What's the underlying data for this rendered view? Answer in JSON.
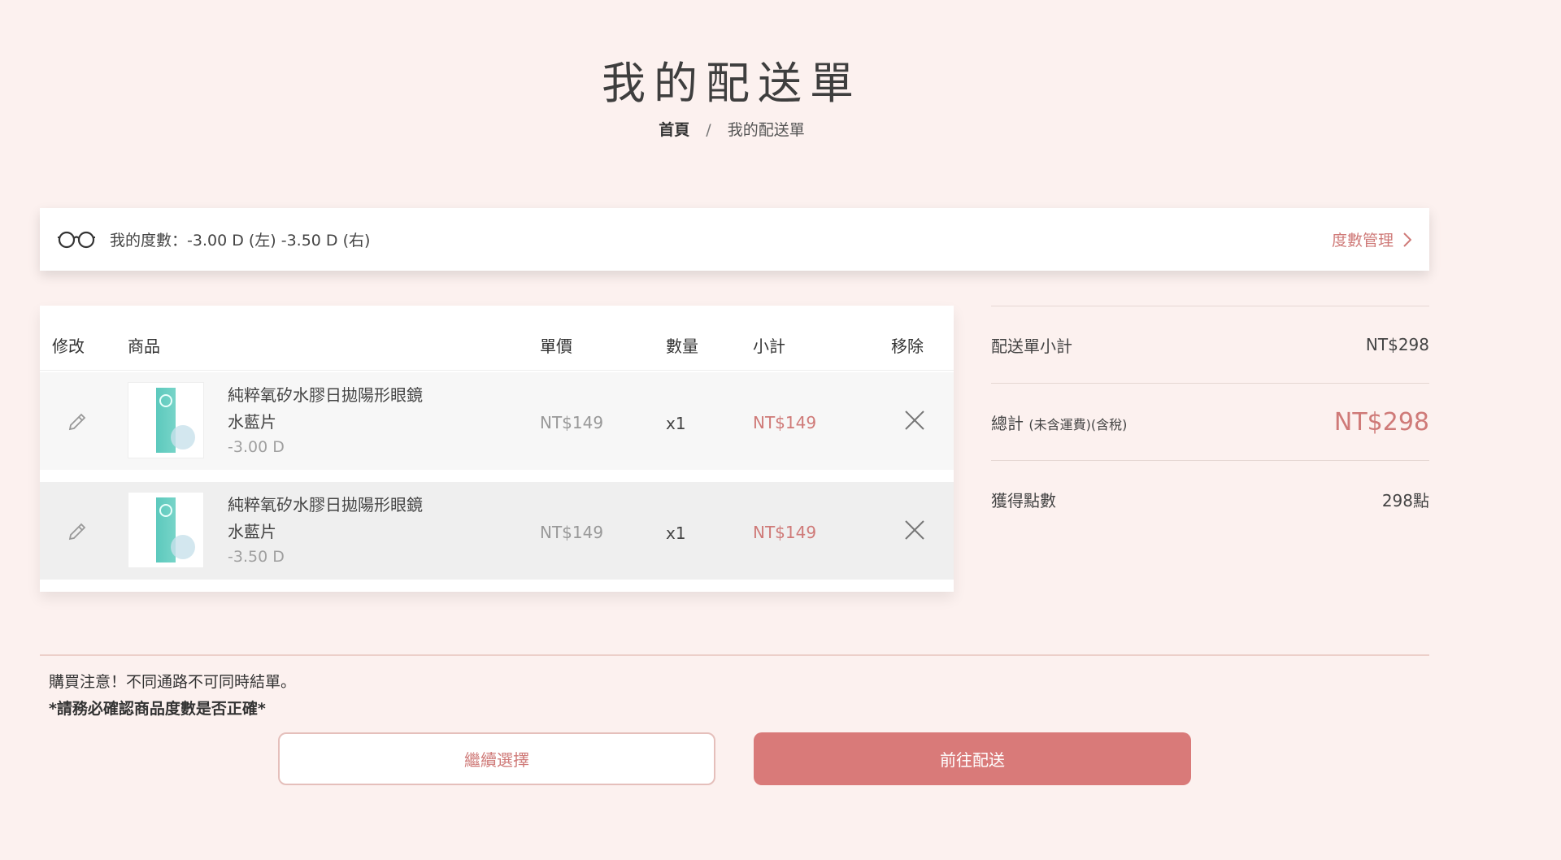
{
  "page": {
    "title": "我的配送單"
  },
  "breadcrumb": {
    "home": "首頁",
    "separator": "/",
    "current": "我的配送單"
  },
  "prescription": {
    "text": "我的度數：-3.00 D (左) -3.50 D (右)",
    "manage_label": "度數管理",
    "icon": "glasses-icon"
  },
  "cart": {
    "columns": {
      "edit": "修改",
      "product": "商品",
      "unit_price": "單價",
      "quantity": "數量",
      "subtotal": "小計",
      "remove": "移除"
    },
    "items": [
      {
        "name": "純粹氧矽水膠日拋陽形眼鏡",
        "variant": "水藍片",
        "power": "-3.00 D",
        "unit_price": "NT$149",
        "quantity": "x1",
        "subtotal": "NT$149"
      },
      {
        "name": "純粹氧矽水膠日拋陽形眼鏡",
        "variant": "水藍片",
        "power": "-3.50 D",
        "unit_price": "NT$149",
        "quantity": "x1",
        "subtotal": "NT$149"
      }
    ]
  },
  "summary": {
    "subtotal_label": "配送單小計",
    "subtotal_value": "NT$298",
    "total_label": "總計",
    "total_note": "(未含運費)(含稅)",
    "total_value": "NT$298",
    "points_label": "獲得點數",
    "points_value": "298點"
  },
  "notes": {
    "line1": "購買注意！不同通路不可同時結單。",
    "line2": "*請務必確認商品度數是否正確*"
  },
  "buttons": {
    "continue": "繼續選擇",
    "checkout": "前往配送"
  },
  "colors": {
    "background": "#fcf1ef",
    "accent": "#d97a79",
    "price_accent": "#cf7a78"
  }
}
